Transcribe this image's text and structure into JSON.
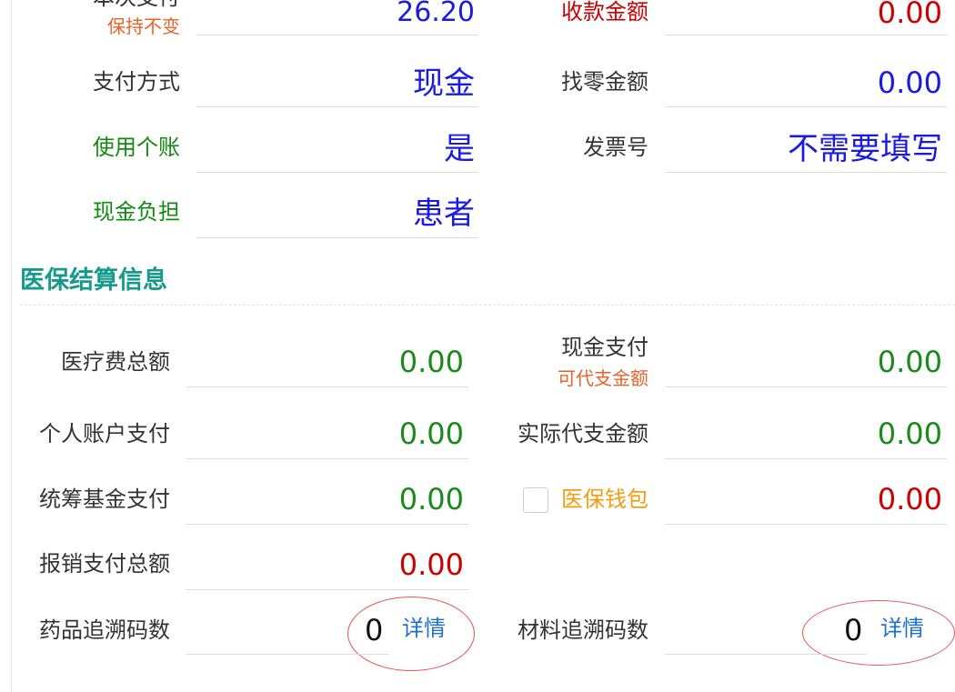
{
  "top": {
    "benci_label": "本次支付",
    "benci_sub": "保持不变",
    "benci_value": "26.20",
    "shoukuan_label": "收款金额",
    "shoukuan_value": "0.00",
    "payment_method_label": "支付方式",
    "payment_method_value": "现金",
    "change_label": "找零金额",
    "change_value": "0.00",
    "use_personal_label": "使用个账",
    "use_personal_value": "是",
    "invoice_label": "发票号",
    "invoice_value": "不需要填写",
    "cash_burden_label": "现金负担",
    "cash_burden_value": "患者"
  },
  "section": {
    "title": "医保结算信息"
  },
  "settlement": {
    "medical_total_label": "医疗费总额",
    "medical_total_value": "0.00",
    "cash_pay_label": "现金支付",
    "cash_pay_sub": "可代支金额",
    "cash_pay_value": "0.00",
    "personal_account_label": "个人账户支付",
    "personal_account_value": "0.00",
    "actual_proxy_label": "实际代支金额",
    "actual_proxy_value": "0.00",
    "pooled_fund_label": "统筹基金支付",
    "pooled_fund_value": "0.00",
    "wallet_label": "医保钱包",
    "wallet_value": "0.00",
    "reimburse_total_label": "报销支付总额",
    "reimburse_total_value": "0.00",
    "drug_trace_label": "药品追溯码数",
    "drug_trace_count": "0",
    "drug_trace_link": "详情",
    "material_trace_label": "材料追溯码数",
    "material_trace_count": "0",
    "material_trace_link": "详情"
  },
  "colors": {
    "accent_teal": "#159a8c",
    "value_blue": "#1a1ae6",
    "value_red": "#cc0000",
    "value_green": "#1a8a1a",
    "sublabel_orange": "#e8622a",
    "wallet_orange": "#f39c12",
    "link_blue": "#1f6fd1",
    "annotation_red": "#e25555"
  },
  "icons": {
    "wallet_checkbox": "checkbox-unchecked"
  }
}
